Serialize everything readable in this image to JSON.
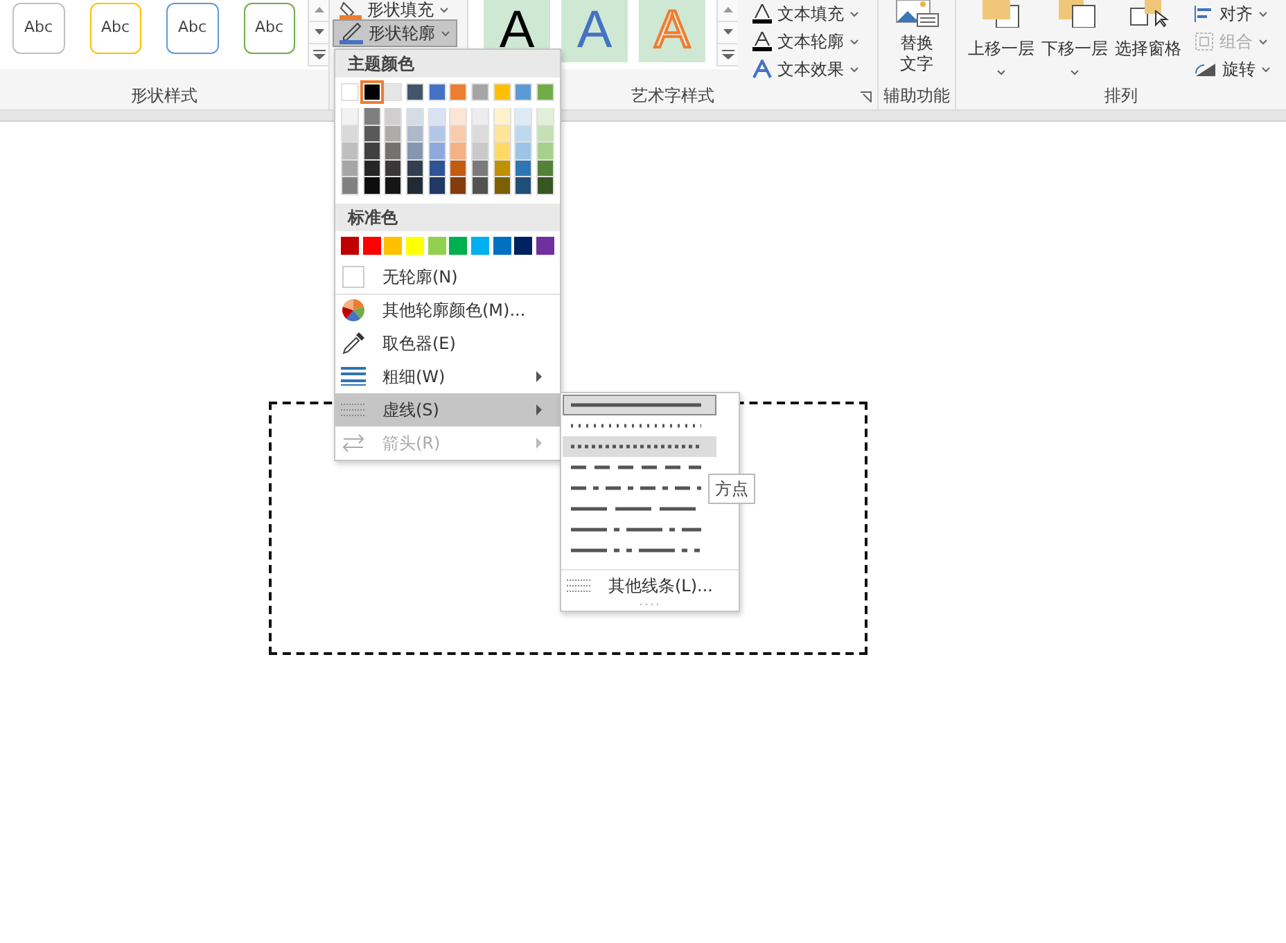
{
  "shape_styles": {
    "label": "形状样式",
    "gallery": [
      {
        "text": "Abc",
        "color": "#c0c0c0"
      },
      {
        "text": "Abc",
        "color": "#ffc000"
      },
      {
        "text": "Abc",
        "color": "#5b9bd5"
      },
      {
        "text": "Abc",
        "color": "#70ad47"
      }
    ]
  },
  "shape_commands": [
    {
      "label": "形状填充",
      "pressed": false
    },
    {
      "label": "形状轮廓",
      "pressed": true
    }
  ],
  "wordart_styles": {
    "label": "艺术字样式",
    "gallery": [
      {
        "text": "A",
        "kind": "black"
      },
      {
        "text": "A",
        "kind": "blue"
      },
      {
        "text": "A",
        "kind": "orange-outline"
      }
    ],
    "commands": [
      {
        "label": "文本填充",
        "kind": "fill"
      },
      {
        "label": "文本轮廓",
        "kind": "outline"
      },
      {
        "label": "文本效果",
        "kind": "effect"
      }
    ]
  },
  "accessibility": {
    "label": "辅助功能",
    "button": "替换文字"
  },
  "arrange": {
    "label": "排列",
    "buttons": [
      {
        "label": "上移一层",
        "kind": "forward"
      },
      {
        "label": "下移一层",
        "kind": "backward"
      },
      {
        "label": "选择窗格",
        "kind": "pane"
      }
    ],
    "commands": [
      {
        "label": "对齐",
        "kind": "align",
        "disabled": false
      },
      {
        "label": "组合",
        "kind": "group",
        "disabled": true
      },
      {
        "label": "旋转",
        "kind": "rotate",
        "disabled": false
      }
    ]
  },
  "outline_menu": {
    "theme_header": "主题颜色",
    "theme_colors": [
      {
        "color": "#ffffff",
        "selected": false,
        "shades": [
          {
            "color": "#f2f2f2"
          },
          {
            "color": "#d9d9d9"
          },
          {
            "color": "#bfbfbf"
          },
          {
            "color": "#a6a6a6"
          },
          {
            "color": "#808080"
          }
        ]
      },
      {
        "color": "#000000",
        "selected": true,
        "shades": [
          {
            "color": "#7f7f7f"
          },
          {
            "color": "#595959"
          },
          {
            "color": "#404040"
          },
          {
            "color": "#262626"
          },
          {
            "color": "#0d0d0d"
          }
        ]
      },
      {
        "color": "#e7e6e6",
        "selected": false,
        "shades": [
          {
            "color": "#d0cece"
          },
          {
            "color": "#aeabab"
          },
          {
            "color": "#757171"
          },
          {
            "color": "#3a3838"
          },
          {
            "color": "#171616"
          }
        ]
      },
      {
        "color": "#44546a",
        "selected": false,
        "shades": [
          {
            "color": "#d6dce4"
          },
          {
            "color": "#adb9ca"
          },
          {
            "color": "#8496b0"
          },
          {
            "color": "#333f4f"
          },
          {
            "color": "#222a35"
          }
        ]
      },
      {
        "color": "#4472c4",
        "selected": false,
        "shades": [
          {
            "color": "#d9e2f3"
          },
          {
            "color": "#b4c6e7"
          },
          {
            "color": "#8eaadb"
          },
          {
            "color": "#2f5496"
          },
          {
            "color": "#1f3864"
          }
        ]
      },
      {
        "color": "#ed7d31",
        "selected": false,
        "shades": [
          {
            "color": "#fbe5d5"
          },
          {
            "color": "#f7cbac"
          },
          {
            "color": "#f4b183"
          },
          {
            "color": "#c55a11"
          },
          {
            "color": "#843c0b"
          }
        ]
      },
      {
        "color": "#a5a5a5",
        "selected": false,
        "shades": [
          {
            "color": "#ededed"
          },
          {
            "color": "#dbdbdb"
          },
          {
            "color": "#c9c9c9"
          },
          {
            "color": "#7b7b7b"
          },
          {
            "color": "#525252"
          }
        ]
      },
      {
        "color": "#ffc000",
        "selected": false,
        "shades": [
          {
            "color": "#fff2cc"
          },
          {
            "color": "#ffe599"
          },
          {
            "color": "#ffd966"
          },
          {
            "color": "#bf9000"
          },
          {
            "color": "#7f6000"
          }
        ]
      },
      {
        "color": "#5b9bd5",
        "selected": false,
        "shades": [
          {
            "color": "#deebf6"
          },
          {
            "color": "#bdd7ee"
          },
          {
            "color": "#9dc3e6"
          },
          {
            "color": "#2e75b5"
          },
          {
            "color": "#1f4e79"
          }
        ]
      },
      {
        "color": "#70ad47",
        "selected": false,
        "shades": [
          {
            "color": "#e2efd9"
          },
          {
            "color": "#c5e0b3"
          },
          {
            "color": "#a8d08d"
          },
          {
            "color": "#538135"
          },
          {
            "color": "#375623"
          }
        ]
      }
    ],
    "standard_header": "标准色",
    "standard_colors": [
      {
        "color": "#c00000"
      },
      {
        "color": "#ff0000"
      },
      {
        "color": "#ffc000"
      },
      {
        "color": "#ffff00"
      },
      {
        "color": "#92d050"
      },
      {
        "color": "#00b050"
      },
      {
        "color": "#00b0f0"
      },
      {
        "color": "#0070c0"
      },
      {
        "color": "#002060"
      },
      {
        "color": "#7030a0"
      }
    ],
    "items": [
      {
        "kind": "no-outline",
        "label": "无轮廓(N)",
        "has_submenu": false,
        "selected": false,
        "disabled": false
      },
      {
        "kind": "more-colors",
        "label": "其他轮廓颜色(M)...",
        "has_submenu": false,
        "selected": false,
        "disabled": false
      },
      {
        "kind": "eyedropper",
        "label": "取色器(E)",
        "has_submenu": false,
        "selected": false,
        "disabled": false
      },
      {
        "kind": "weight",
        "label": "粗细(W)",
        "has_submenu": true,
        "selected": false,
        "disabled": false
      },
      {
        "kind": "dashes",
        "label": "虚线(S)",
        "has_submenu": true,
        "selected": true,
        "disabled": false
      },
      {
        "kind": "arrows",
        "label": "箭头(R)",
        "has_submenu": true,
        "selected": false,
        "disabled": true
      }
    ]
  },
  "dash_menu": {
    "styles": [
      {
        "kind": "solid",
        "selected": true,
        "hovered": false
      },
      {
        "kind": "round-dot",
        "selected": false,
        "hovered": false
      },
      {
        "kind": "square-dot",
        "selected": false,
        "hovered": true
      },
      {
        "kind": "dash",
        "selected": false,
        "hovered": false
      },
      {
        "kind": "dash-dot",
        "selected": false,
        "hovered": false
      },
      {
        "kind": "long-dash",
        "selected": false,
        "hovered": false
      },
      {
        "kind": "long-dash-dot",
        "selected": false,
        "hovered": false
      },
      {
        "kind": "long-dash-dot-dot",
        "selected": false,
        "hovered": false
      }
    ],
    "more": "其他线条(L)...",
    "tooltip": "方点"
  }
}
